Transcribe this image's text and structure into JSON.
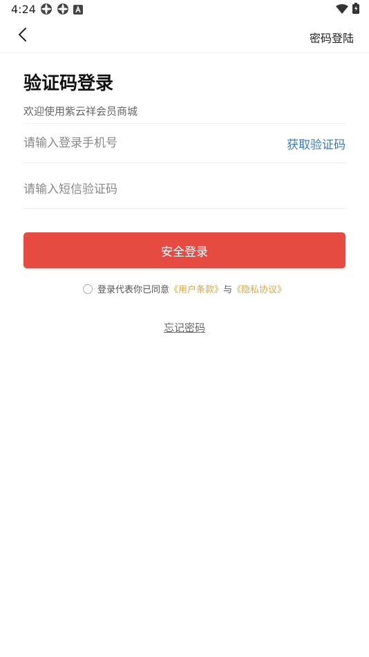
{
  "status_bar": {
    "time": "4:24",
    "left_icons": [
      "settings-icon",
      "settings-icon",
      "a-box-icon"
    ],
    "right_icons": [
      "wifi-icon",
      "battery-icon"
    ]
  },
  "nav": {
    "back_icon": "chevron-left-icon",
    "right_link": "密码登陆"
  },
  "page": {
    "title": "验证码登录",
    "welcome": "欢迎使用紫云祥会员商城"
  },
  "form": {
    "phone_placeholder": "请输入登录手机号",
    "phone_value": "",
    "get_code_label": "获取验证码",
    "code_placeholder": "请输入短信验证码",
    "code_value": ""
  },
  "login_button_label": "安全登录",
  "agreement": {
    "prefix": "登录代表你已同意",
    "terms": "《用户条款》",
    "and": "与",
    "privacy": "《隐私协议》",
    "checked": false
  },
  "forgot_password": "忘记密码",
  "colors": {
    "primary_button": "#e64b42",
    "link_blue": "#3a78c8",
    "link_orange": "#f0a23a"
  }
}
